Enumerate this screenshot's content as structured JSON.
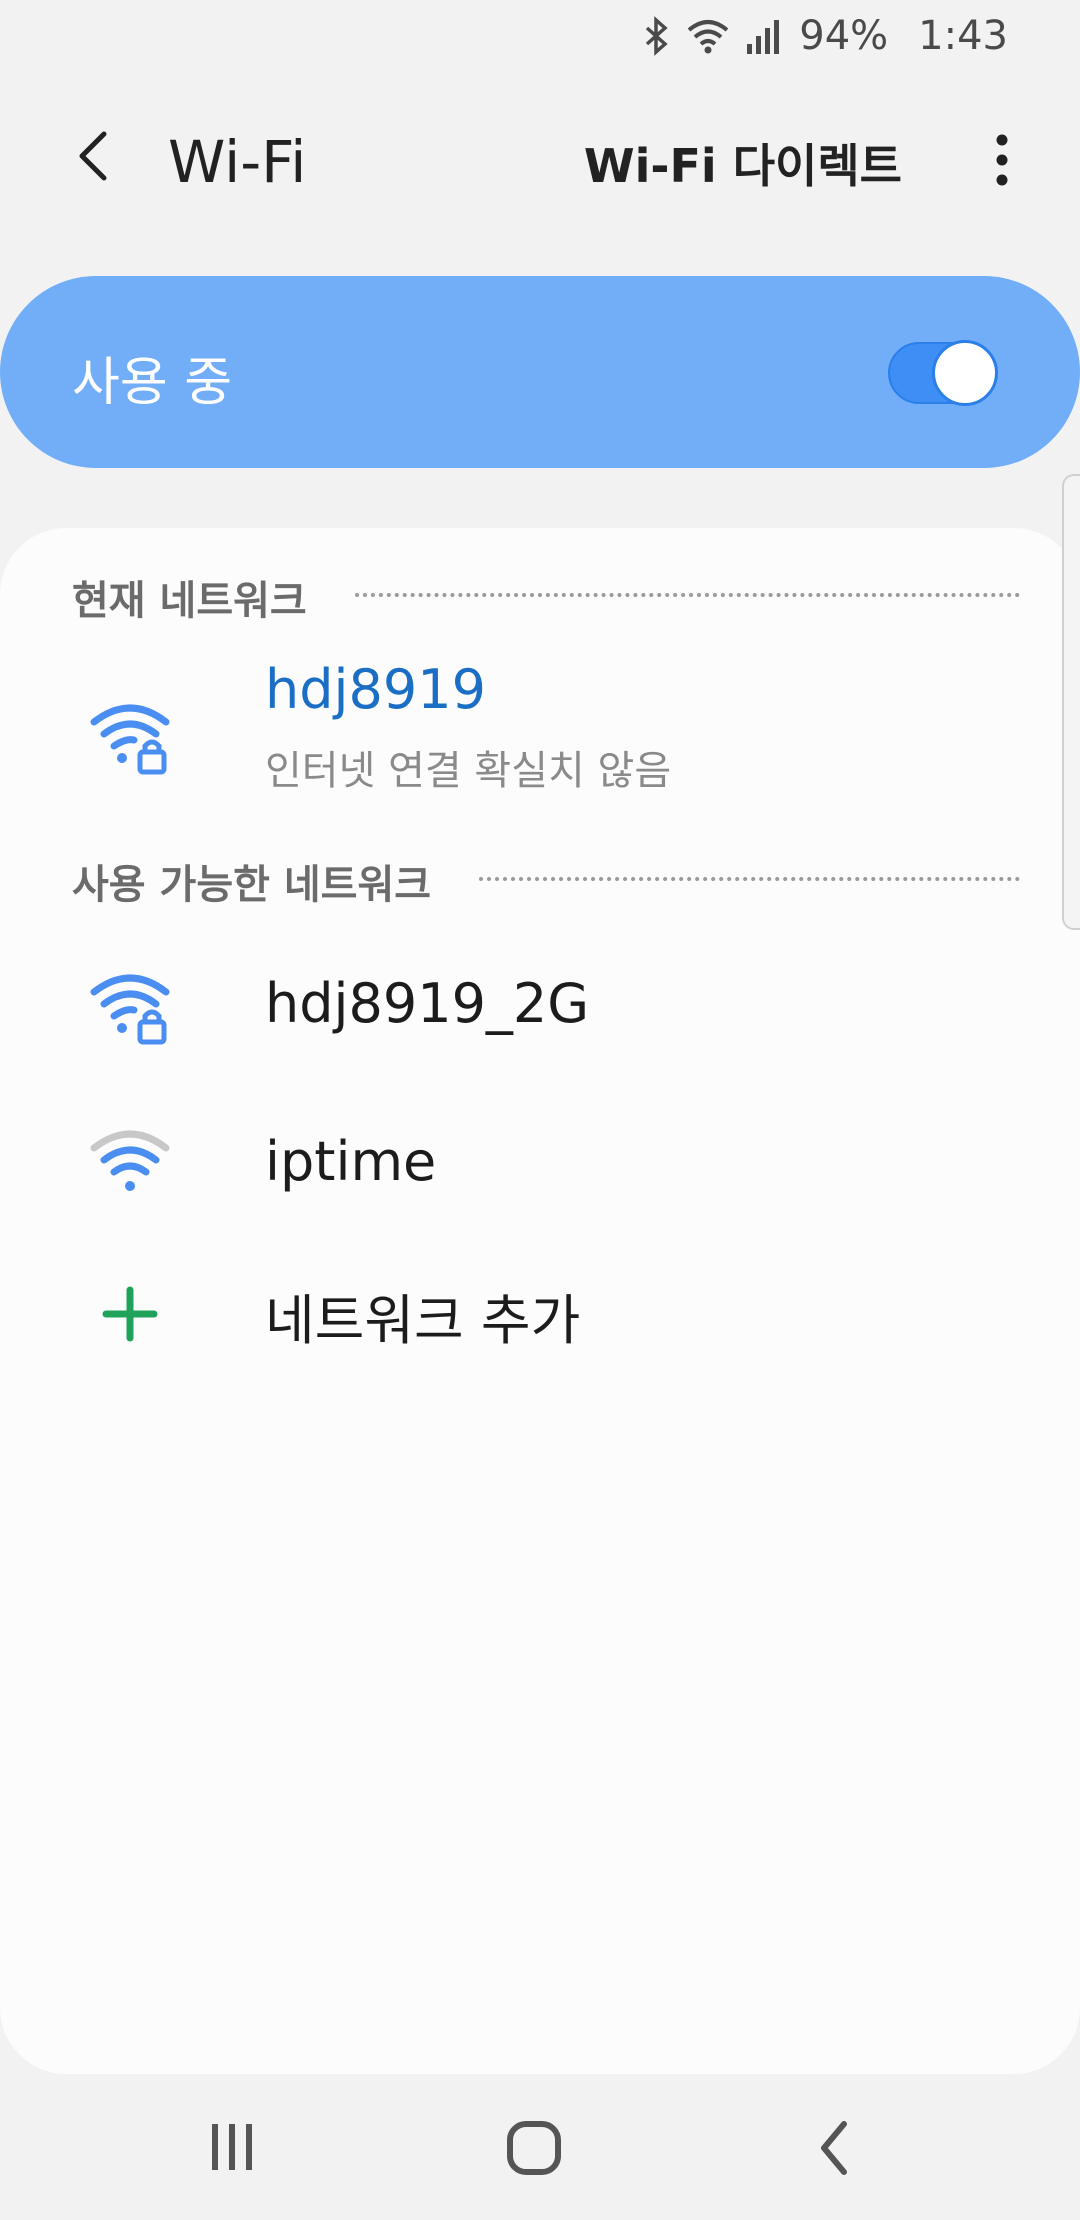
{
  "status_bar": {
    "icons": [
      "bluetooth-icon",
      "wifi-icon",
      "signal-icon"
    ],
    "battery": "94%",
    "time": "1:43"
  },
  "app_bar": {
    "title": "Wi-Fi",
    "wifi_direct_label": "Wi-Fi 다이렉트",
    "back_icon": "chevron-left-icon",
    "more_icon": "more-vert-icon"
  },
  "master_switch": {
    "label": "사용 중",
    "on": true,
    "accent": "#72aef8"
  },
  "current_network": {
    "header": "현재 네트워크",
    "name": "hdj8919",
    "status": "인터넷 연결 확실치 않음",
    "icon": "wifi-locked-icon"
  },
  "available_networks": {
    "header": "사용 가능한 네트워크",
    "items": [
      {
        "name": "hdj8919_2G",
        "icon": "wifi-locked-icon"
      },
      {
        "name": "iptime",
        "icon": "wifi-open-icon"
      }
    ],
    "add_label": "네트워크 추가"
  },
  "nav_bar": {
    "buttons": [
      "recent-apps-icon",
      "home-icon",
      "back-icon"
    ]
  }
}
